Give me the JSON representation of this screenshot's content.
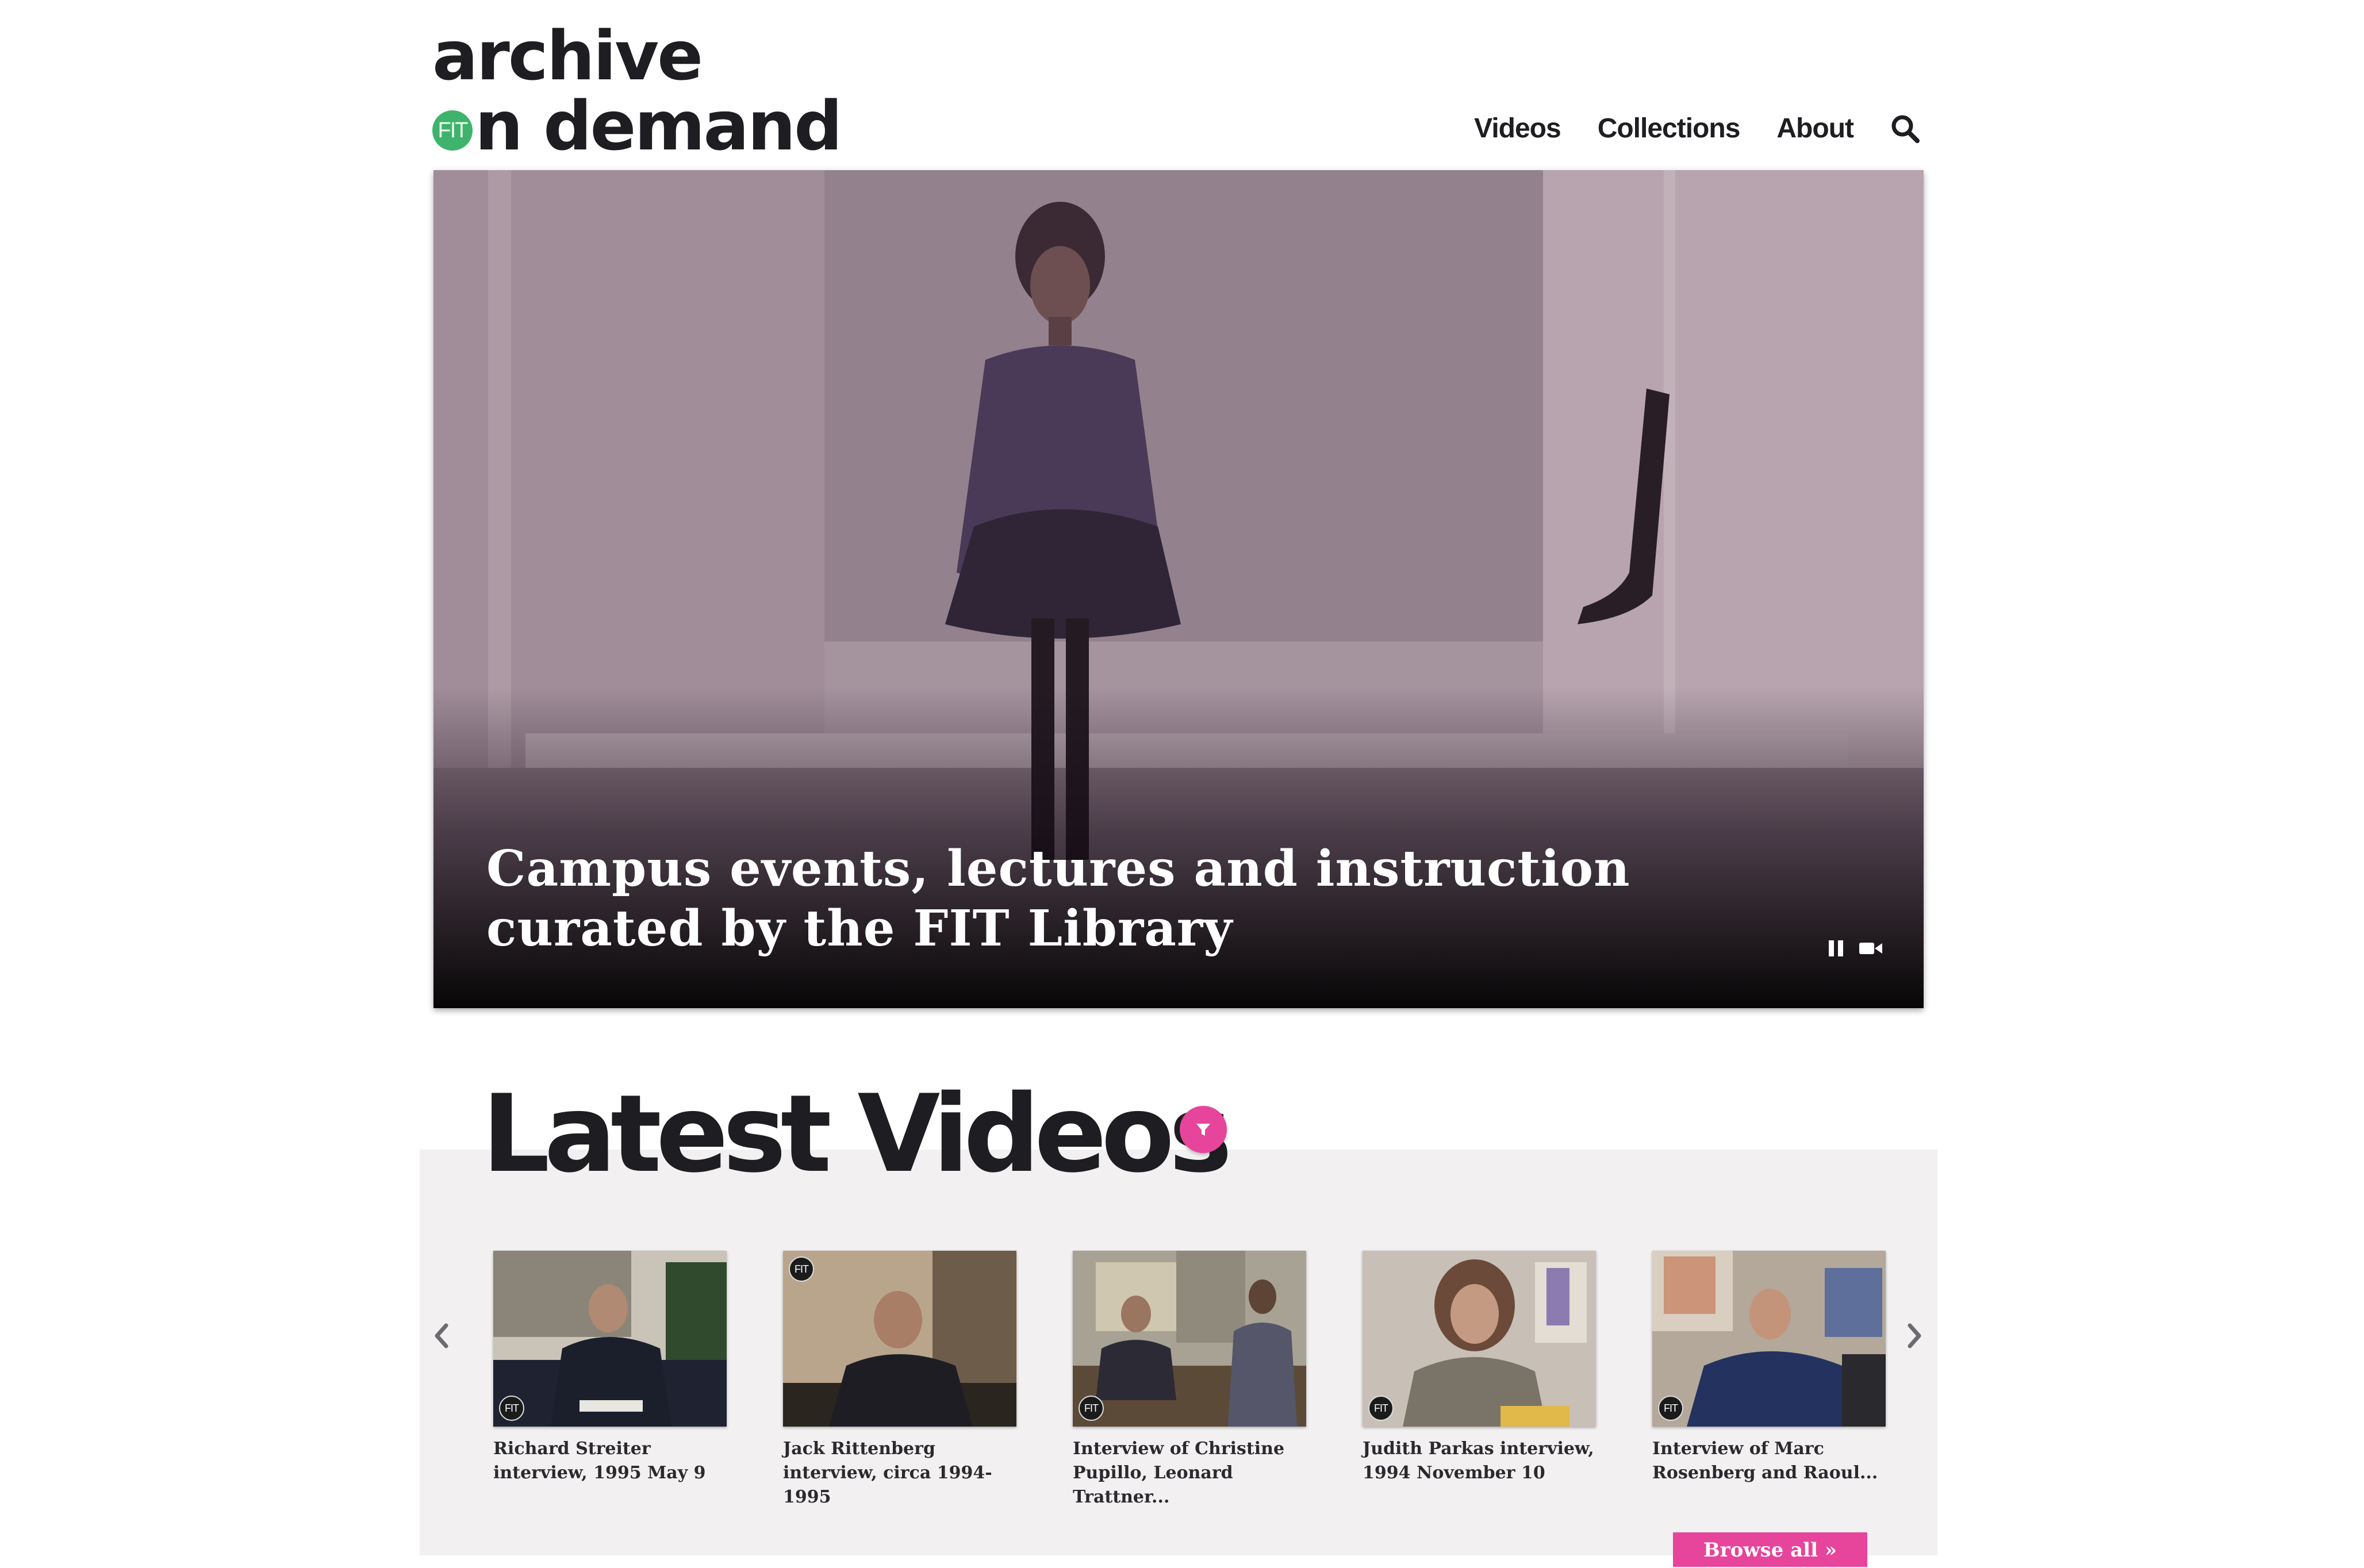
{
  "header": {
    "logo": {
      "line1": "archive",
      "badge": "FIT",
      "line2": "n demand"
    },
    "nav": [
      "Videos",
      "Collections",
      "About"
    ]
  },
  "hero": {
    "caption": "Campus events, lectures and instruction curated by the FIT Library"
  },
  "latest": {
    "title": "Latest Videos",
    "cards": [
      {
        "title": "Richard Streiter interview, 1995 May 9",
        "badge": "FIT"
      },
      {
        "title": "Jack Rittenberg interview, circa 1994-1995",
        "badge": "FIT"
      },
      {
        "title": "Interview of Christine Pupillo, Leonard Trattner...",
        "badge": "FIT"
      },
      {
        "title": "Judith Parkas interview, 1994 November 10",
        "badge": "FIT"
      },
      {
        "title": "Interview of Marc Rosenberg and Raoul...",
        "badge": "FIT"
      }
    ],
    "browse_label": "Browse all »"
  },
  "colors": {
    "accent": "#e7449b",
    "logo_green": "#3fb36b",
    "text": "#1e1e22",
    "band": "#f2f0f1"
  },
  "icons": [
    "search-icon",
    "pause-icon",
    "video-camera-icon",
    "filter-icon",
    "chevron-left-icon",
    "chevron-right-icon"
  ]
}
